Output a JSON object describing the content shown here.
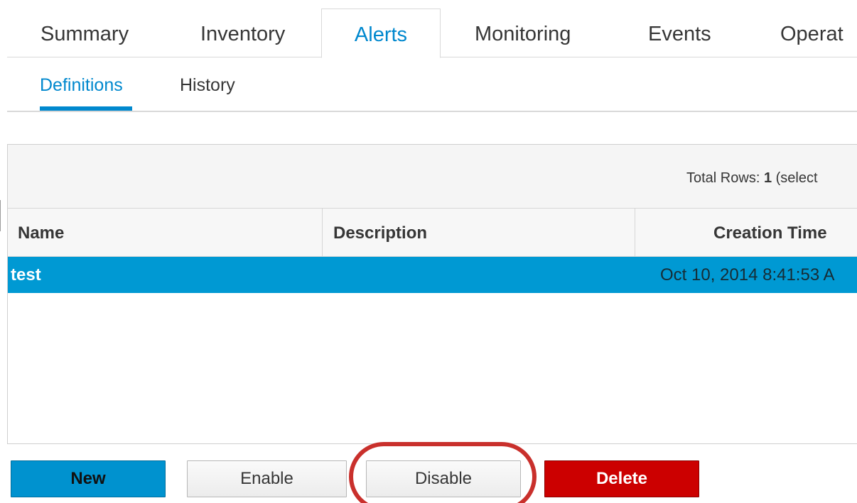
{
  "main_tabs": [
    {
      "label": "Summary"
    },
    {
      "label": "Inventory"
    },
    {
      "label": "Alerts"
    },
    {
      "label": "Monitoring"
    },
    {
      "label": "Events"
    },
    {
      "label": "Operat"
    }
  ],
  "main_tabs_active": "Alerts",
  "sub_tabs": [
    {
      "label": "Definitions"
    },
    {
      "label": "History"
    }
  ],
  "sub_tabs_active": "Definitions",
  "grid": {
    "total_rows_label": "Total Rows:",
    "total_rows_count": "1",
    "total_rows_suffix": "(select",
    "columns": [
      "Name",
      "Description",
      "Creation Time"
    ],
    "rows": [
      {
        "name": "test",
        "description": "",
        "creation_time": "Oct 10, 2014 8:41:53 A",
        "selected": true
      }
    ]
  },
  "actions": {
    "new_label": "New",
    "enable_label": "Enable",
    "disable_label": "Disable",
    "delete_label": "Delete"
  },
  "colors": {
    "accent": "#0088ce",
    "selected_row": "#0099d3",
    "danger": "#cc0000",
    "annotation_ring": "#c9302c"
  }
}
